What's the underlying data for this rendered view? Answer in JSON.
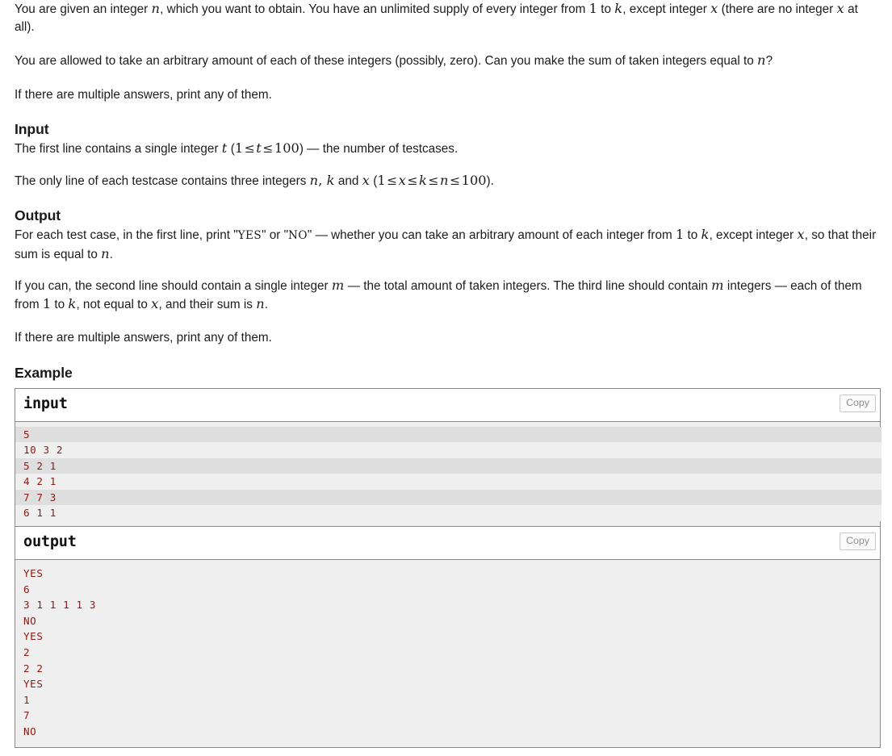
{
  "statement": {
    "p1": {
      "t1": "You are given an integer ",
      "v1": "n",
      "t2": ", which you want to obtain. You have an unlimited supply of every integer from ",
      "v2": "1",
      "t3": " to ",
      "v3": "k",
      "t4": ", except integer ",
      "v4": "x",
      "t5": " (there are no integer ",
      "v5": "x",
      "t6": " at all)."
    },
    "p2": {
      "t1": "You are allowed to take an arbitrary amount of each of these integers (possibly, zero). Can you make the sum of taken integers equal to ",
      "v1": "n",
      "t2": "?"
    },
    "p3": "If there are multiple answers, print any of them."
  },
  "input_section": {
    "heading": "Input",
    "p1": {
      "t1": "The first line contains a single integer ",
      "v1": "t",
      "t2": " (",
      "v2": "1",
      "rel1": "≤",
      "v3": "t",
      "rel2": "≤",
      "v4": "100",
      "t3": ") — the number of testcases."
    },
    "p2": {
      "t1": "The only line of each testcase contains three integers ",
      "v1": "n",
      "t2": ", ",
      "v2": "k",
      "t3": " and ",
      "v3": "x",
      "t4": " (",
      "v4": "1",
      "rel1": "≤",
      "v5": "x",
      "rel2": "≤",
      "v6": "k",
      "rel3": "≤",
      "v7": "n",
      "rel4": "≤",
      "v8": "100",
      "t5": ")."
    }
  },
  "output_section": {
    "heading": "Output",
    "p1": {
      "t1": "For each test case, in the first line, print \"",
      "lit1": "YES",
      "t2": "\" or \"",
      "lit2": "NO",
      "t3": "\" — whether you can take an arbitrary amount of each integer from ",
      "v1": "1",
      "t4": " to ",
      "v2": "k",
      "t5": ", except integer ",
      "v3": "x",
      "t6": ", so that their sum is equal to ",
      "v4": "n",
      "t7": "."
    },
    "p2": {
      "t1": "If you can, the second line should contain a single integer ",
      "v1": "m",
      "t2": " — the total amount of taken integers. The third line should contain ",
      "v2": "m",
      "t3": " integers — each of them from ",
      "v3": "1",
      "t4": " to ",
      "v4": "k",
      "t5": ", not equal to ",
      "v5": "x",
      "t6": ", and their sum is ",
      "v6": "n",
      "t7": "."
    },
    "p3": "If there are multiple answers, print any of them."
  },
  "example": {
    "heading": "Example",
    "copy_label": "Copy",
    "blocks": [
      {
        "title": "input",
        "striped": true,
        "lines": [
          "5",
          "10 3 2",
          "5 2 1",
          "4 2 1",
          "7 7 3",
          "6 1 1"
        ]
      },
      {
        "title": "output",
        "striped": false,
        "lines": [
          "YES",
          "6",
          "3 1 1 1 1 3",
          "NO",
          "YES",
          "2",
          "2 2",
          "YES",
          "1",
          "7",
          "NO"
        ]
      }
    ]
  },
  "colors": {
    "sample_text": "#8b1a12",
    "stripe_dark": "#dedede",
    "stripe_light": "#efefef",
    "border": "#8a8a8a",
    "copy_text": "#8d8d8d"
  }
}
